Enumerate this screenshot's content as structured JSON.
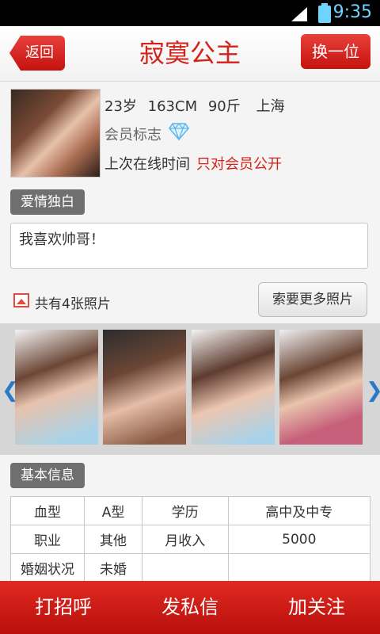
{
  "status_bar": {
    "time": "9:35"
  },
  "header": {
    "back_label": "返回",
    "title": "寂寞公主",
    "switch_label": "换一位"
  },
  "profile": {
    "age": "23岁",
    "height": "163CM",
    "weight": "90斤",
    "city": "上海",
    "member_label": "会员标志",
    "online_label": "上次在线时间",
    "online_value": "只对会员公开"
  },
  "love_section": {
    "tag": "爱情独白",
    "text": "我喜欢帅哥！"
  },
  "photos": {
    "count_text": "共有4张照片",
    "more_button": "索要更多照片"
  },
  "basic_section": {
    "tag": "基本信息",
    "rows": [
      [
        "血型",
        "A型",
        "学历",
        "高中及中专"
      ],
      [
        "职业",
        "其他",
        "月收入",
        "5000"
      ],
      [
        "婚姻状况",
        "未婚",
        "",
        ""
      ]
    ]
  },
  "actions": {
    "greet": "打招呼",
    "message": "发私信",
    "follow": "加关注"
  },
  "colors": {
    "accent_red": "#d3221a",
    "tag_gray": "#6f6f6f",
    "diamond_blue": "#5ab4e8"
  }
}
